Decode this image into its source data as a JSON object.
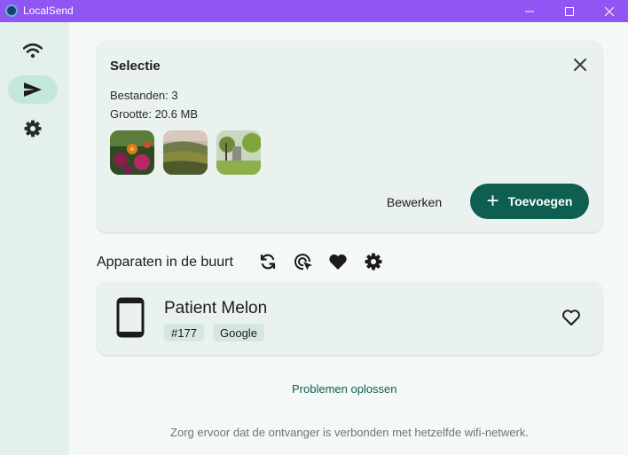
{
  "window": {
    "title": "LocalSend",
    "minimize_icon": "minimize-icon",
    "maximize_icon": "maximize-icon",
    "close_icon": "close-icon"
  },
  "sidebar": {
    "items": [
      {
        "name": "receive",
        "icon": "wifi-icon",
        "active": false
      },
      {
        "name": "send",
        "icon": "send-icon",
        "active": true
      },
      {
        "name": "settings",
        "icon": "gear-icon",
        "active": false
      }
    ]
  },
  "selection": {
    "title": "Selectie",
    "files_line": "Bestanden: 3",
    "size_line": "Grootte: 20.6 MB",
    "thumbnails": [
      "flowers-photo",
      "valley-photo",
      "park-photo"
    ],
    "edit_label": "Bewerken",
    "add_label": "Toevoegen",
    "add_icon": "plus-icon",
    "close_icon": "close-icon"
  },
  "nearby": {
    "title": "Apparaten in de buurt",
    "tools": [
      "refresh-icon",
      "scan-target-icon",
      "heart-icon",
      "gear-icon"
    ]
  },
  "device": {
    "name": "Patient Melon",
    "badges": [
      "#177",
      "Google"
    ],
    "icon": "smartphone-icon",
    "favorite_icon": "heart-outline-icon"
  },
  "troubleshoot_label": "Problemen oplossen",
  "hint_text": "Zorg ervoor dat de ontvanger is verbonden met hetzelfde wifi-netwerk.",
  "colors": {
    "accent": "#0f5e52",
    "titlebar": "#9155f3",
    "sidebar": "#e3f0ec",
    "card": "#eaf2ef",
    "badge": "#d6e7e1"
  }
}
